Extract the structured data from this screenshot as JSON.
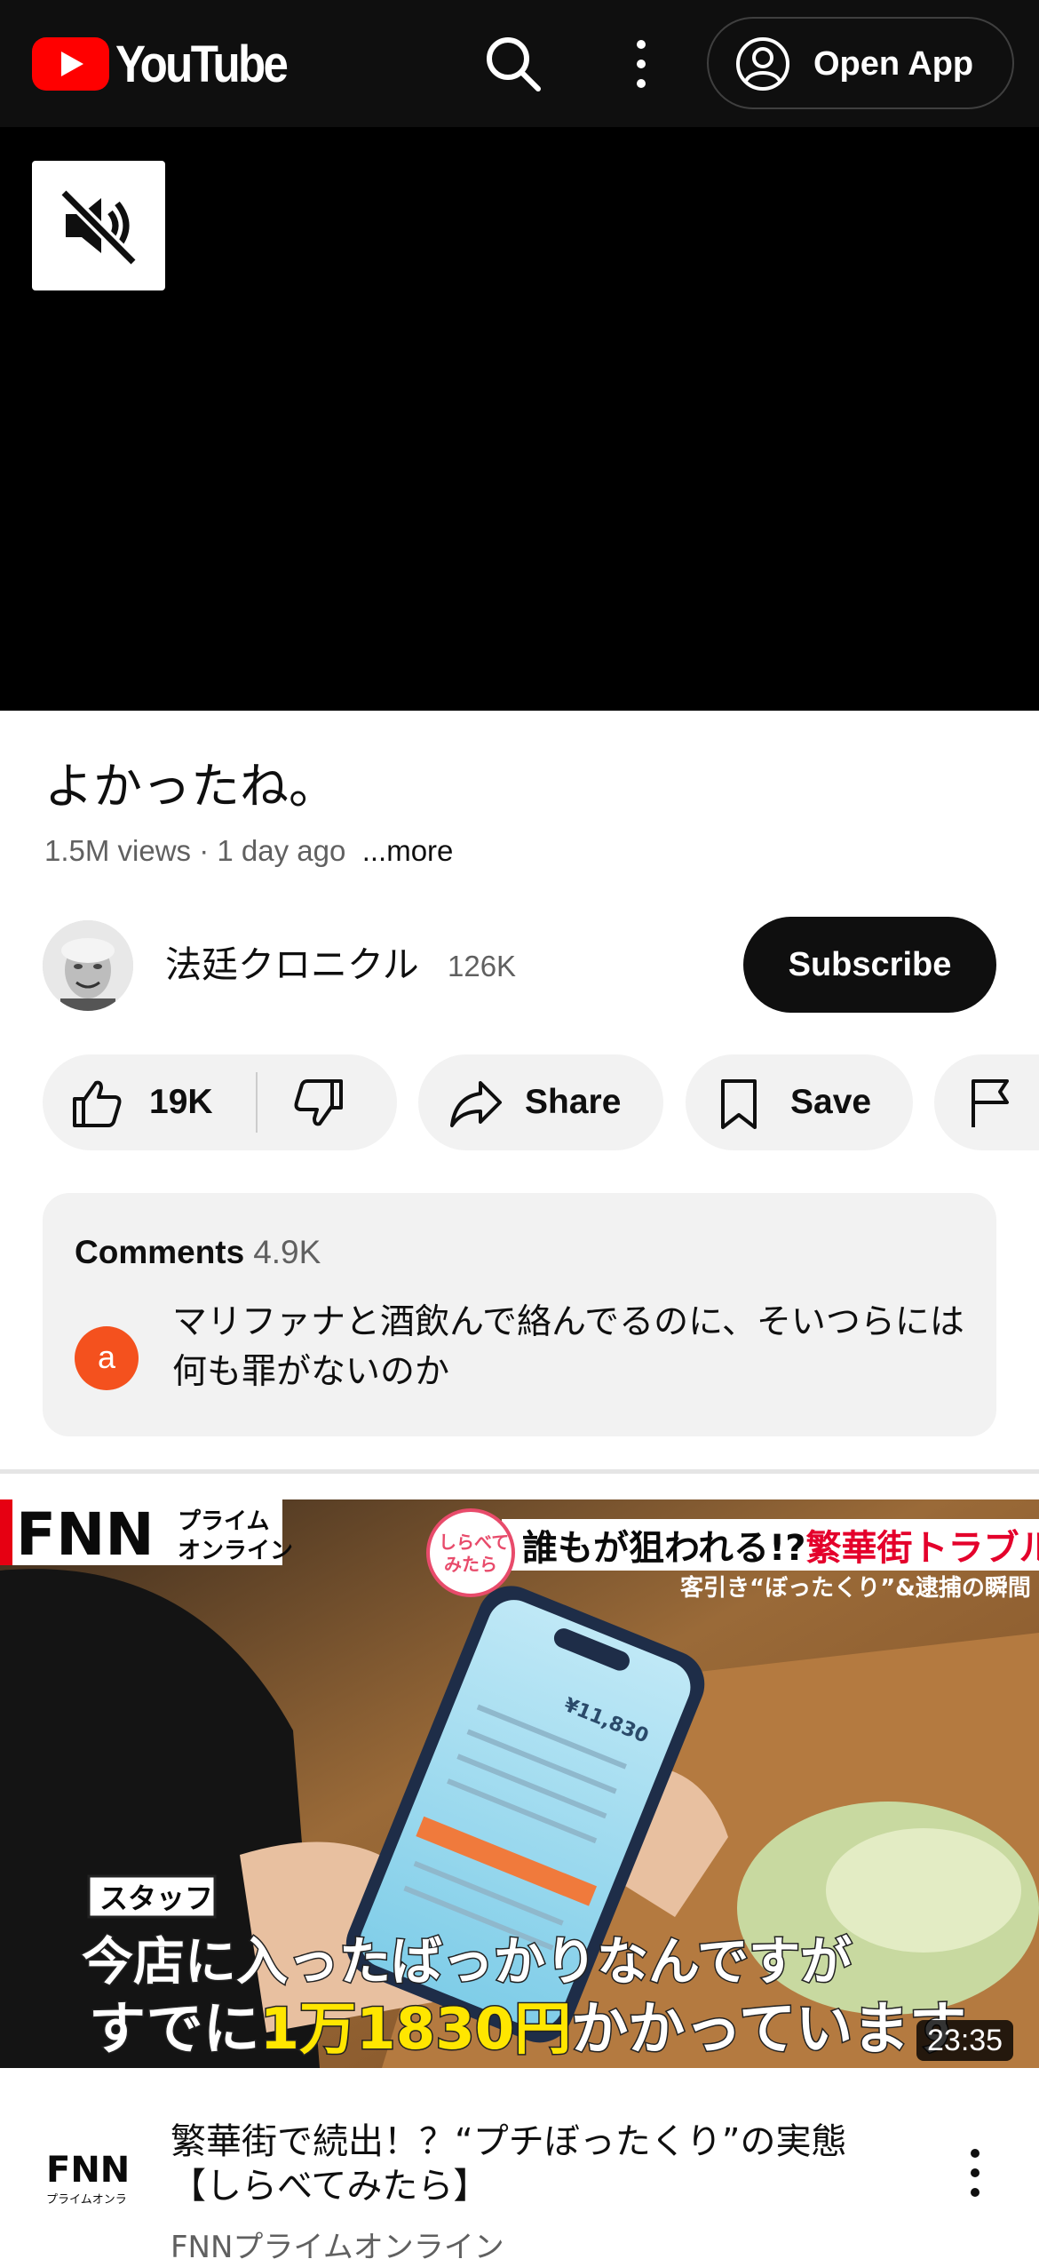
{
  "header": {
    "logo_text": "YouTube",
    "search_icon": "search-icon",
    "more_icon": "more-vert-icon",
    "open_app_label": "Open App",
    "open_app_icon": "account-circle-icon",
    "bg_color": "#0f0f0f",
    "brand_color": "#ff0000"
  },
  "player": {
    "mute_icon": "volume-off-icon"
  },
  "video": {
    "title": "よかったね。",
    "views": "1.5M views",
    "separator": " · ",
    "age": "1 day ago",
    "more_label": "...more"
  },
  "channel": {
    "name": "法廷クロニクル",
    "subscribers": "126K",
    "subscribe_label": "Subscribe"
  },
  "actions": {
    "like_count": "19K",
    "share_label": "Share",
    "save_label": "Save"
  },
  "comments": {
    "label": "Comments",
    "count": "4.9K",
    "top_comment": {
      "avatar_letter": "a",
      "text": "マリファナと酒飲んで絡んでるのに、そいつらには何も罪がないのか"
    }
  },
  "next_video": {
    "thumbnail": {
      "logo_text": "FNN",
      "logo_sub_1": "プライム",
      "logo_sub_2": "オンライン",
      "badge_1": "しらべて",
      "badge_2": "みたら",
      "headline_white": "誰もが狙われる!?",
      "headline_red": "繁華街トラブル",
      "subheadline": "客引き“ぼったくり”&逮捕の瞬間",
      "speaker_label": "スタッフ",
      "caption_line1": "今店に入ったばっかりなんですが",
      "caption_line2_a": "すでに",
      "caption_line2_b": "1万1830円",
      "caption_line2_c": "かかっています",
      "phone_amount": "¥11,830"
    },
    "duration": "23:35",
    "title": "繁華街で続出！？“プチぼったくり”の実態【しらべてみたら】",
    "channel_logo_text": "FNN",
    "channel_logo_sub": "プライムオンライン",
    "channel_name": "FNNプライムオンライン"
  }
}
